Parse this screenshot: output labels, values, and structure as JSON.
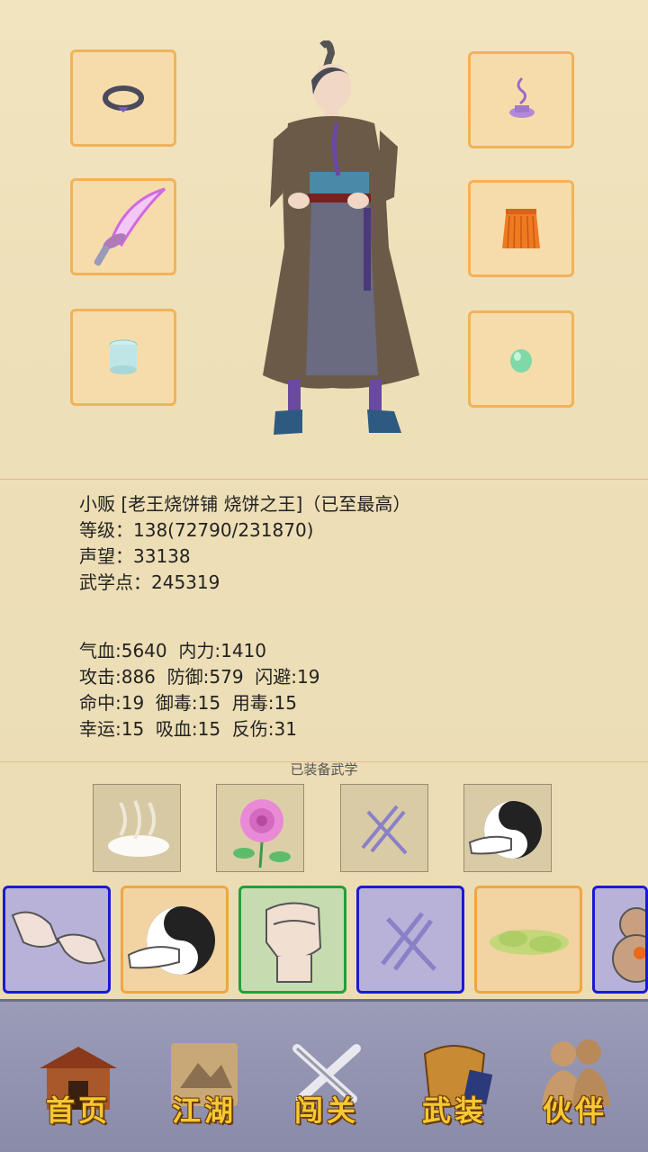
{
  "character": {
    "title_line": "小贩 [老王烧饼铺 烧饼之王]（已至最高）",
    "level_line": "等级：138(72790/231870)",
    "reputation_line": "声望：33138",
    "martial_points_line": "武学点：245319"
  },
  "stats": {
    "row1": "气血:5640  内力:1410",
    "row2": "攻击:886  防御:579  闪避:19",
    "row3": "命中:19  御毒:15  用毒:15",
    "row4": "幸运:15  吸血:15  反伤:31"
  },
  "equipment": {
    "left": [
      "ring-icon",
      "sabre-icon",
      "bracer-icon"
    ],
    "right": [
      "incense-icon",
      "skirt-armor-icon",
      "jade-icon"
    ]
  },
  "equipped_skills": {
    "label": "已装备武学",
    "items": [
      "cloud-skill-icon",
      "rose-skill-icon",
      "fan-skill-icon",
      "taiji-palm-icon"
    ]
  },
  "skill_bar": {
    "items": [
      {
        "icon": "fist-clash-icon",
        "frame": "blue"
      },
      {
        "icon": "taiji-palm-icon",
        "frame": "orange"
      },
      {
        "icon": "fist-icon",
        "frame": "green"
      },
      {
        "icon": "fan-skill-icon",
        "frame": "blue"
      },
      {
        "icon": "green-mist-icon",
        "frame": "orange"
      },
      {
        "icon": "gourd-icon",
        "frame": "blue"
      }
    ]
  },
  "nav": {
    "home": "首页",
    "jianghu": "江湖",
    "chuangguan": "闯关",
    "wuzhuang": "武装",
    "huoban": "伙伴"
  },
  "colors": {
    "slot_border": "#f2b25a",
    "frame_blue": "#1a1ad2",
    "frame_orange": "#f0a640",
    "frame_green": "#21a03a",
    "nav_text": "#f6c832"
  }
}
